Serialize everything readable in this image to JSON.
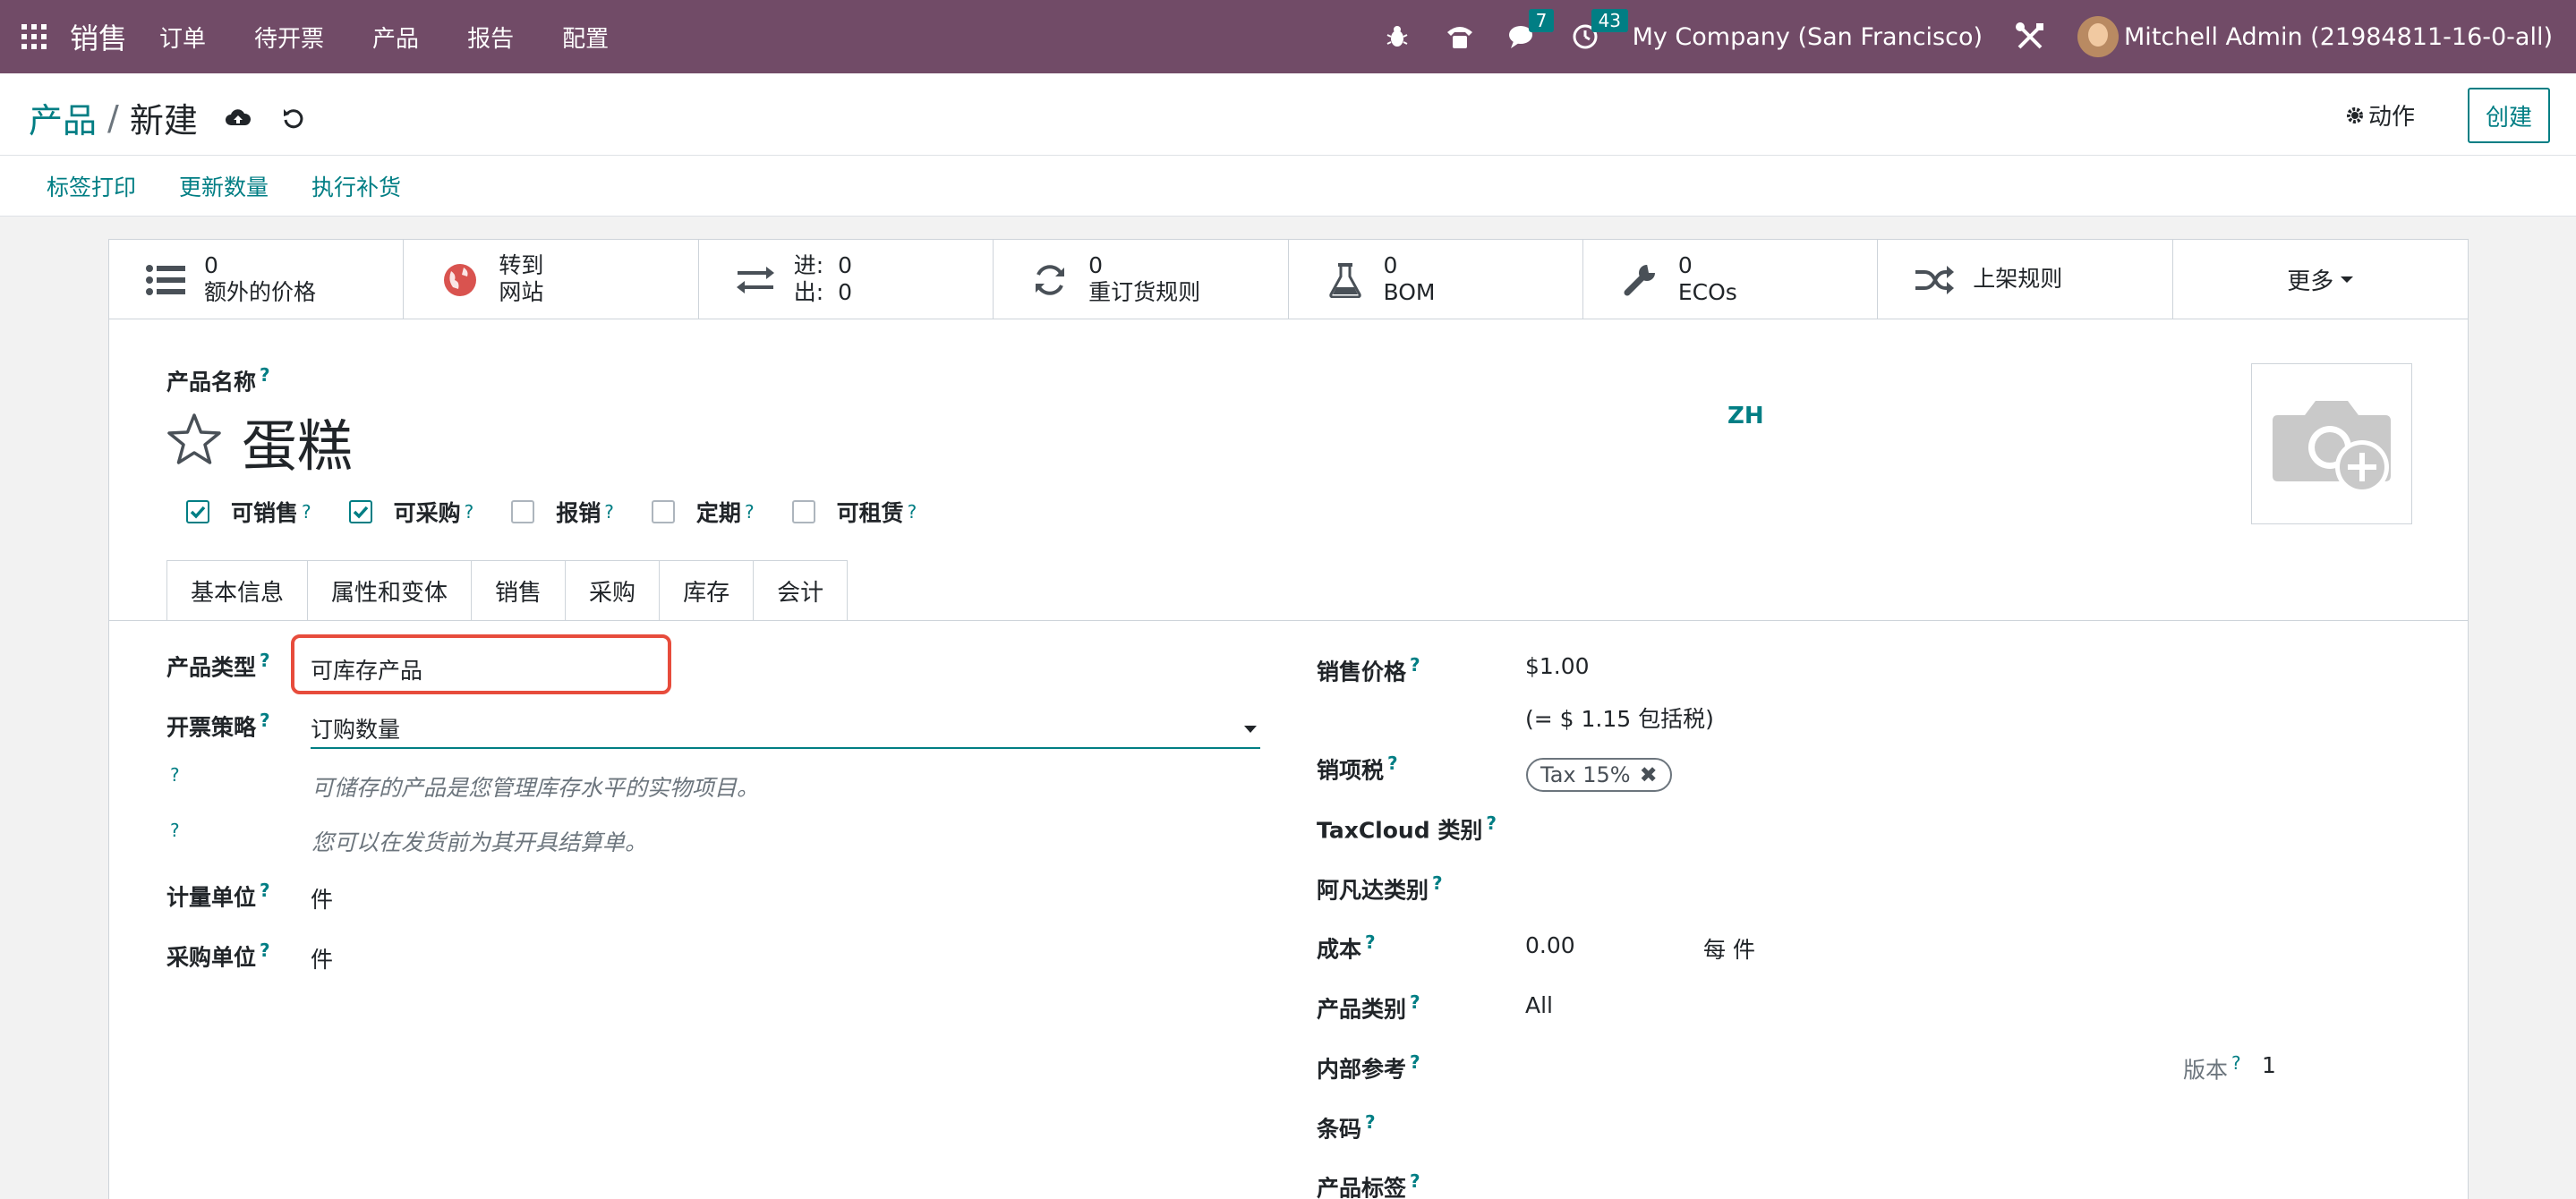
{
  "app": {
    "brand": "销售"
  },
  "nav": {
    "items": [
      "订单",
      "待开票",
      "产品",
      "报告",
      "配置"
    ]
  },
  "systray": {
    "messages_count": "7",
    "activities_count": "43",
    "company": "My Company (San Francisco)",
    "user": "Mitchell Admin (21984811-16-0-all)"
  },
  "control": {
    "breadcrumb_parent": "产品",
    "breadcrumb_sep": "/",
    "breadcrumb_current": "新建",
    "actions_label": "动作",
    "create_label": "创建"
  },
  "header_buttons": [
    "标签打印",
    "更新数量",
    "执行补货"
  ],
  "smart_buttons": {
    "extra_prices": {
      "value": "0",
      "label": "额外的价格"
    },
    "website": {
      "line1": "转到",
      "line2": "网站"
    },
    "in_out": {
      "in_label": "进:",
      "in_value": "0",
      "out_label": "出:",
      "out_value": "0"
    },
    "reorder": {
      "value": "0",
      "label": "重订货规则"
    },
    "bom": {
      "value": "0",
      "label": "BOM"
    },
    "ecos": {
      "value": "0",
      "label": "ECOs"
    },
    "putaway": {
      "label": "上架规则"
    },
    "more": {
      "label": "更多"
    }
  },
  "form": {
    "name_label": "产品名称",
    "q": "?",
    "product_name": "蛋糕",
    "lang": "ZH",
    "checkboxes": [
      {
        "label": "可销售",
        "checked": true
      },
      {
        "label": "可采购",
        "checked": true
      },
      {
        "label": "报销",
        "checked": false
      },
      {
        "label": "定期",
        "checked": false
      },
      {
        "label": "可租赁",
        "checked": false
      }
    ],
    "tabs": [
      "基本信息",
      "属性和变体",
      "销售",
      "采购",
      "库存",
      "会计"
    ],
    "left": {
      "product_type_label": "产品类型",
      "product_type_value": "可库存产品",
      "invoice_policy_label": "开票策略",
      "invoice_policy_value": "订购数量",
      "help1": "可储存的产品是您管理库存水平的实物项目。",
      "help2": "您可以在发货前为其开具结算单。",
      "uom_label": "计量单位",
      "uom_value": "件",
      "purchase_uom_label": "采购单位",
      "purchase_uom_value": "件"
    },
    "right": {
      "sales_price_label": "销售价格",
      "sales_price_value": "$1.00",
      "sales_price_incl": "(= $ 1.15 包括税)",
      "sales_tax_label": "销项税",
      "sales_tax_tag": "Tax 15%",
      "taxcloud_label": "TaxCloud 类别",
      "avatax_label": "阿凡达类别",
      "cost_label": "成本",
      "cost_value": "0.00",
      "cost_unit": "每 件",
      "category_label": "产品类别",
      "category_value": "All",
      "internal_ref_label": "内部参考",
      "version_label": "版本",
      "version_value": "1",
      "barcode_label": "条码",
      "tags_label": "产品标签"
    }
  }
}
